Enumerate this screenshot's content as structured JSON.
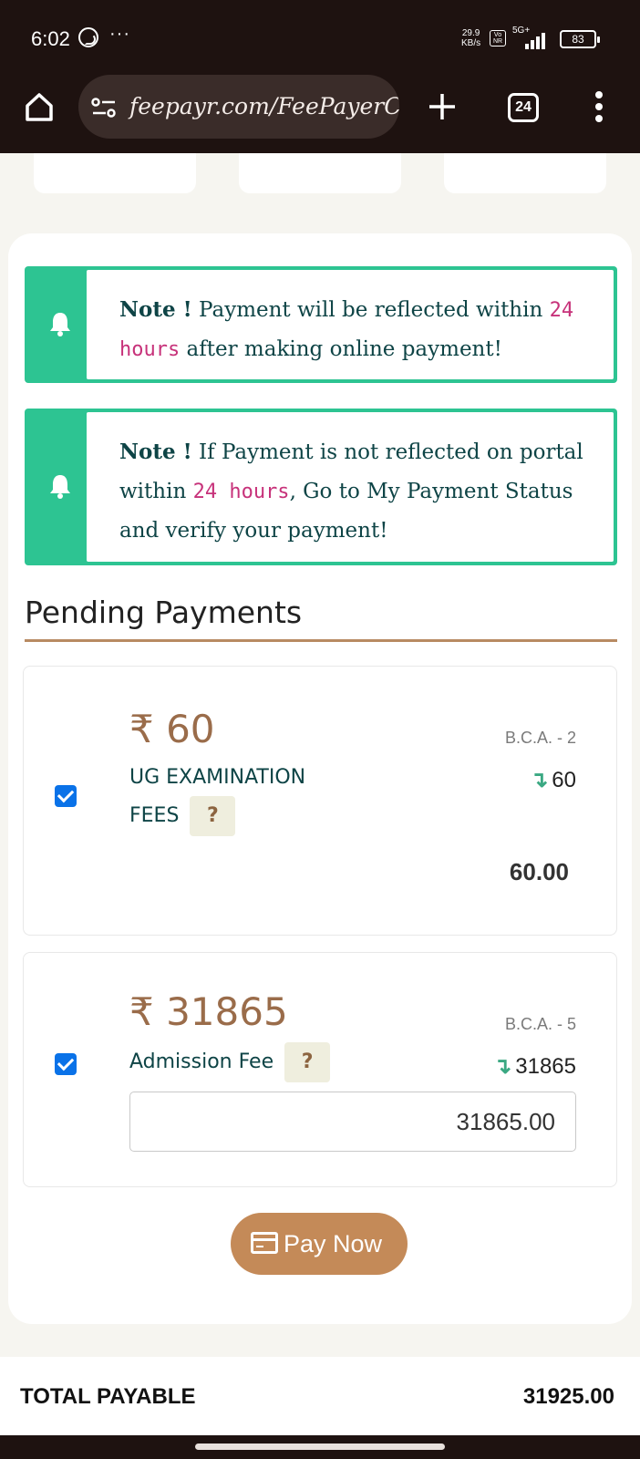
{
  "status_bar": {
    "time": "6:02",
    "overflow": "···",
    "net_speed_value": "29.9",
    "net_speed_unit": "KB/s",
    "volte": "Vo NR",
    "network": "5G+",
    "battery": "83"
  },
  "browser": {
    "url": "feepayr.com/FeePayerC",
    "tab_count": "24"
  },
  "notes": [
    {
      "label": "Note !",
      "pre": " Payment will be reflected within ",
      "highlight": "24 hours",
      "post": " after making online payment!"
    },
    {
      "label": "Note !",
      "pre": " If Payment is not reflected on portal within ",
      "highlight": "24 hours",
      "post": ", Go to My Payment Status and verify your payment!"
    }
  ],
  "pending": {
    "title": "Pending Payments",
    "items": [
      {
        "checked": true,
        "amount_display": "₹ 60",
        "name": "UG EXAMINATION FEES",
        "help": "?",
        "course": "B.C.A. - 2",
        "due": "60",
        "pay_amount": "60.00"
      },
      {
        "checked": true,
        "amount_display": "₹ 31865",
        "name": "Admission Fee",
        "help": "?",
        "course": "B.C.A. - 5",
        "due": "31865",
        "pay_amount": "31865.00"
      }
    ]
  },
  "pay_button": "Pay Now",
  "total": {
    "label": "TOTAL PAYABLE",
    "value": "31925.00"
  },
  "colors": {
    "accent": "#c48a58",
    "note_border": "#2dc492",
    "checkbox": "#0a72e8",
    "chrome": "#1e1210"
  }
}
